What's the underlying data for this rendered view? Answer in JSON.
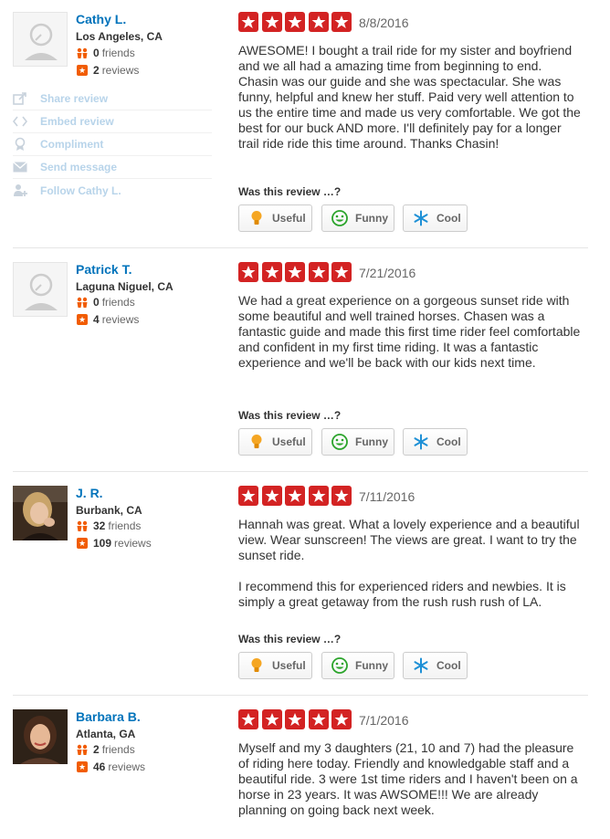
{
  "vote_prompt": "Was this review …?",
  "buttons": {
    "useful": "Useful",
    "funny": "Funny",
    "cool": "Cool"
  },
  "colors": {
    "star_red": "#d32323",
    "link_blue": "#0073bb",
    "stat_orange": "#f15c00"
  },
  "reviews": [
    {
      "user": {
        "name": "Cathy L.",
        "location": "Los Angeles, CA",
        "friends": "0",
        "friends_label": "friends",
        "reviews": "2",
        "reviews_label": "reviews",
        "avatar": "default-avatar-icon"
      },
      "rating": 5,
      "date": "8/8/2016",
      "paragraphs": [
        "AWESOME! I bought a trail ride for my sister and boyfriend and we all had a amazing time from beginning to end. Chasin was our guide and she was spectacular. She was funny, helpful and knew her stuff. Paid very well attention to us the entire time and made us very comfortable. We got the best for our buck AND more. I'll definitely pay for a longer trail ride ride this time around. Thanks Chasin!"
      ],
      "actions": [
        "Share review",
        "Embed review",
        "Compliment",
        "Send message",
        "Follow Cathy L."
      ]
    },
    {
      "user": {
        "name": "Patrick T.",
        "location": "Laguna Niguel, CA",
        "friends": "0",
        "friends_label": "friends",
        "reviews": "4",
        "reviews_label": "reviews",
        "avatar": "default-avatar-icon"
      },
      "rating": 5,
      "date": "7/21/2016",
      "paragraphs": [
        "We had a great experience on a gorgeous sunset ride with some beautiful and well trained horses. Chasen was a fantastic guide and made this first time rider feel comfortable and confident in my first time riding. It was a fantastic experience and we'll be back with our kids next time."
      ]
    },
    {
      "user": {
        "name": "J. R.",
        "location": "Burbank, CA",
        "friends": "32",
        "friends_label": "friends",
        "reviews": "109",
        "reviews_label": "reviews",
        "avatar": "user-photo"
      },
      "rating": 5,
      "date": "7/11/2016",
      "paragraphs": [
        "Hannah was great. What a lovely experience and a beautiful view. Wear sunscreen! The views are great. I want to try the sunset ride.",
        "I recommend this for experienced riders and newbies. It is simply a great getaway from the rush rush rush of LA."
      ]
    },
    {
      "user": {
        "name": "Barbara B.",
        "location": "Atlanta, GA",
        "friends": "2",
        "friends_label": "friends",
        "reviews": "46",
        "reviews_label": "reviews",
        "avatar": "user-photo"
      },
      "rating": 5,
      "date": "7/1/2016",
      "paragraphs": [
        "Myself and my 3 daughters (21, 10 and 7) had the pleasure of riding here today. Friendly and knowledgable staff and a beautiful ride. 3 were 1st time riders and I haven't been on a horse in 23 years. It was AWSOME!!! We are already planning on going back next week."
      ]
    }
  ]
}
